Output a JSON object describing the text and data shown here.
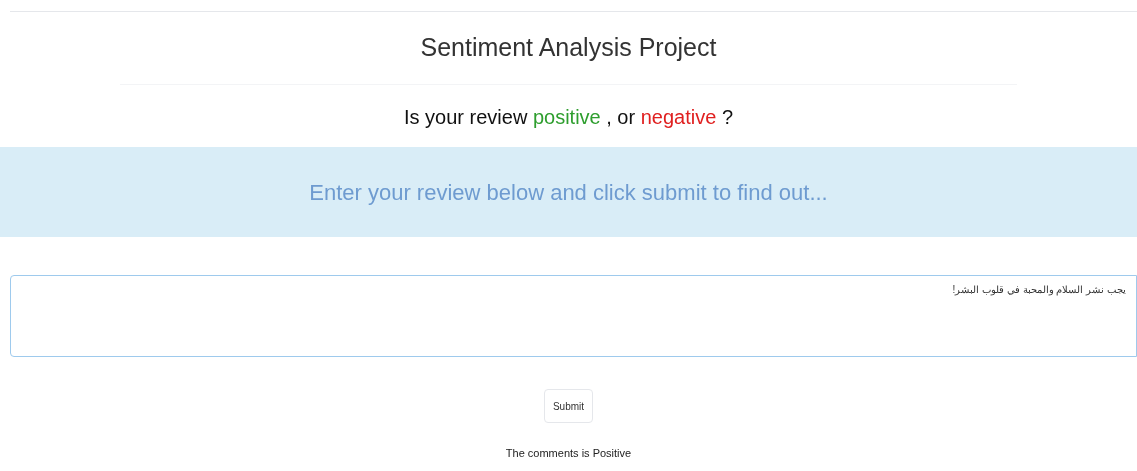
{
  "title": "Sentiment Analysis Project",
  "question": [
    {
      "text": "Is your review ",
      "color": "#111111"
    },
    {
      "text": "positive",
      "color": "#2e9e2e"
    },
    {
      "text": " , or ",
      "color": "#111111"
    },
    {
      "text": "negative",
      "color": "#e02020"
    },
    {
      "text": " ?",
      "color": "#111111"
    }
  ],
  "banner": "Enter your review below and click submit to find out...",
  "review_field": {
    "value": "يجب نشر السلام والمحبة في قلوب البشر!"
  },
  "submit_button": "Submit",
  "result": "The comments is Positive"
}
